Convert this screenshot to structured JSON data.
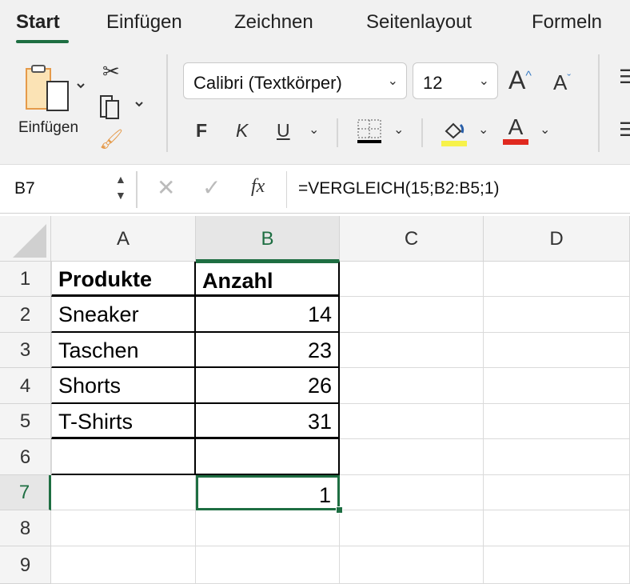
{
  "tabs": [
    {
      "label": "Start",
      "active": true
    },
    {
      "label": "Einfügen"
    },
    {
      "label": "Zeichnen"
    },
    {
      "label": "Seitenlayout"
    },
    {
      "label": "Formeln"
    }
  ],
  "ribbon": {
    "paste_label": "Einfügen",
    "font_name": "Calibri (Textkörper)",
    "font_size": "12",
    "bold": "F",
    "italic": "K",
    "underline": "U",
    "grow_font": "A",
    "shrink_font": "A",
    "font_color_letter": "A",
    "fill_color": "#f7f24a",
    "font_color": "#e0291f"
  },
  "formula_bar": {
    "name_box": "B7",
    "fx": "fx",
    "formula": "=VERGLEICH(15;B2:B5;1)"
  },
  "columns": [
    "A",
    "B",
    "C",
    "D"
  ],
  "rows": [
    "1",
    "2",
    "3",
    "4",
    "5",
    "6",
    "7",
    "8",
    "9"
  ],
  "cells": [
    [
      "Produkte",
      "Anzahl"
    ],
    [
      "Sneaker",
      "14"
    ],
    [
      "Taschen",
      "23"
    ],
    [
      "Shorts",
      "26"
    ],
    [
      "T-Shirts",
      "31"
    ],
    [
      "",
      ""
    ],
    [
      "",
      "1"
    ],
    [
      "",
      ""
    ],
    [
      "",
      ""
    ]
  ],
  "selected_cell": "B7",
  "accent": "#1e6e42"
}
